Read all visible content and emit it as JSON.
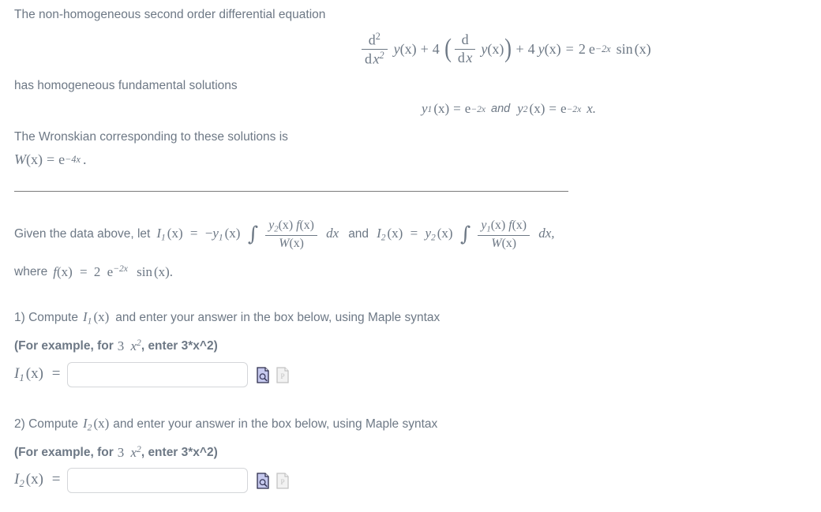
{
  "page": {
    "background": "#ffffff",
    "text_color": "#6d7885",
    "divider_color": "#7b7b7b"
  },
  "intro": {
    "line1": "The non-homogeneous second order differential equation",
    "line2": "has homogeneous fundamental solutions",
    "line3": "The Wronskian corresponding to these solutions is"
  },
  "equation_main": {
    "latex": "d^2/dx^2 y(x) + 4 (d/dx y(x)) + 4 y(x) = 2 e^{-2x} sin(x)",
    "frac1_num": "d",
    "frac1_num_sup": "2",
    "frac1_den_d": "d",
    "frac1_den_x": "x",
    "frac1_den_sup": "2",
    "term1_y": "y",
    "term1_arg": "(x)",
    "plus1": "+",
    "coef1": "4",
    "frac2_num": "d",
    "frac2_den_d": "d",
    "frac2_den_x": "x",
    "term2_y": "y",
    "term2_arg": "(x)",
    "plus2": "+",
    "coef2": "4",
    "term3_y": "y",
    "term3_arg": "(x)",
    "equals": "=",
    "rhs_coef": "2",
    "rhs_e": "e",
    "rhs_exp": "−2x",
    "rhs_sin": "sin",
    "rhs_sin_arg": "(x)"
  },
  "solutions": {
    "y1_name": "y",
    "y1_sub": "1",
    "y1_arg": "(x)",
    "y1_equals": "=",
    "y1_e": "e",
    "y1_exp": "−2x",
    "and": "and",
    "y2_name": "y",
    "y2_sub": "2",
    "y2_arg": "(x)",
    "y2_equals": "=",
    "y2_e": "e",
    "y2_exp": "−2x",
    "y2_tail": "x."
  },
  "wronskian": {
    "w": "W",
    "arg": "(x)",
    "equals": "=",
    "e": "e",
    "exp": "−4x",
    "period": "."
  },
  "given": {
    "lead": "Given the data above, let",
    "I1_name": "I",
    "I1_sub": "1",
    "I1_arg": "(x)",
    "I1_equals": "=",
    "I1_minus": "−",
    "I1_y": "y",
    "I1_y_sub": "1",
    "I1_y_arg": "(x)",
    "int": "∫",
    "I1_frac_num": "y₂(x) f(x)",
    "I1_frac_num_y": "y",
    "I1_frac_num_y_sub": "2",
    "I1_frac_num_y_arg": "(x)",
    "I1_frac_num_f": "f",
    "I1_frac_num_f_arg": "(x)",
    "I1_frac_den_W": "W",
    "I1_frac_den_arg": "(x)",
    "dx": "dx",
    "and": "and",
    "I2_name": "I",
    "I2_sub": "2",
    "I2_arg": "(x)",
    "I2_equals": "=",
    "I2_y": "y",
    "I2_y_sub": "2",
    "I2_y_arg": "(x)",
    "I2_frac_num_y": "y",
    "I2_frac_num_y_sub": "1",
    "I2_frac_num_y_arg": "(x)",
    "I2_frac_num_f": "f",
    "I2_frac_num_f_arg": "(x)",
    "I2_frac_den_W": "W",
    "I2_frac_den_arg": "(x)",
    "dx_comma": "dx,",
    "where_lead": "where",
    "f_name": "f",
    "f_arg": "(x)",
    "f_equals": "=",
    "f_coef": "2",
    "f_e": "e",
    "f_exp": "−2x",
    "f_sin": "sin",
    "f_sin_arg": "(x)",
    "f_period": "."
  },
  "question1": {
    "prompt_pre": "1) Compute",
    "symbol_I": "I",
    "symbol_sub": "1",
    "symbol_arg": "(x)",
    "prompt_post": "and enter your answer in the box below, using Maple syntax",
    "example_pre": "(For example, for",
    "example_num": "3",
    "example_x": "x",
    "example_sup": "2",
    "example_post": ", enter 3*x^2)",
    "label_I": "I",
    "label_sub": "1",
    "label_arg": "(x)",
    "label_equals": "=",
    "input_value": "",
    "input_placeholder": "",
    "preview_icon": "document-preview-icon",
    "palette_icon": "document-palette-icon"
  },
  "question2": {
    "prompt_pre": "2) Compute",
    "symbol_I": "I",
    "symbol_sub": "2",
    "symbol_arg": "(x)",
    "prompt_post": "and enter your answer in the box below, using Maple syntax",
    "example_pre": "(For example, for",
    "example_num": "3",
    "example_x": "x",
    "example_sup": "2",
    "example_post": ", enter 3*x^2)",
    "label_I": "I",
    "label_sub": "2",
    "label_arg": "(x)",
    "label_equals": "=",
    "input_value": "",
    "input_placeholder": "",
    "preview_icon": "document-preview-icon",
    "palette_icon": "document-palette-icon"
  }
}
